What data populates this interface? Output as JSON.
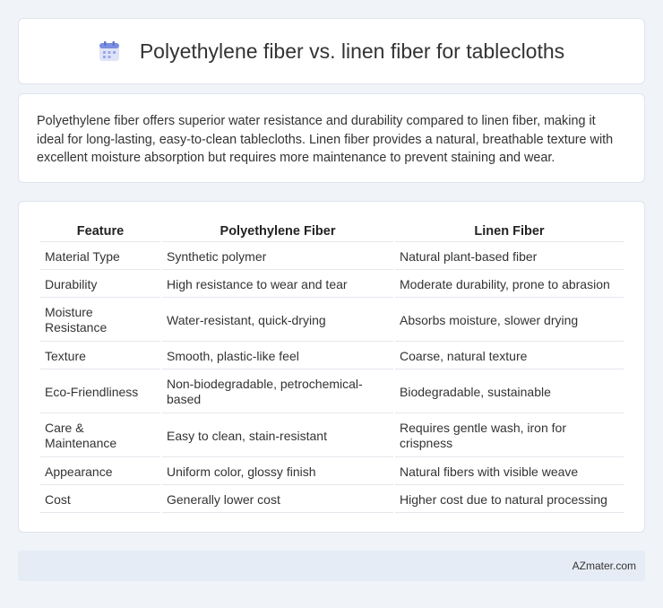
{
  "header": {
    "title": "Polyethylene fiber vs. linen fiber for tablecloths",
    "icon": "calendar-icon"
  },
  "summary": {
    "text": "Polyethylene fiber offers superior water resistance and durability compared to linen fiber, making it ideal for long-lasting, easy-to-clean tablecloths. Linen fiber provides a natural, breathable texture with excellent moisture absorption but requires more maintenance to prevent staining and wear."
  },
  "table": {
    "headers": [
      "Feature",
      "Polyethylene Fiber",
      "Linen Fiber"
    ],
    "rows": [
      [
        "Material Type",
        "Synthetic polymer",
        "Natural plant-based fiber"
      ],
      [
        "Durability",
        "High resistance to wear and tear",
        "Moderate durability, prone to abrasion"
      ],
      [
        "Moisture Resistance",
        "Water-resistant, quick-drying",
        "Absorbs moisture, slower drying"
      ],
      [
        "Texture",
        "Smooth, plastic-like feel",
        "Coarse, natural texture"
      ],
      [
        "Eco-Friendliness",
        "Non-biodegradable, petrochemical-based",
        "Biodegradable, sustainable"
      ],
      [
        "Care & Maintenance",
        "Easy to clean, stain-resistant",
        "Requires gentle wash, iron for crispness"
      ],
      [
        "Appearance",
        "Uniform color, glossy finish",
        "Natural fibers with visible weave"
      ],
      [
        "Cost",
        "Generally lower cost",
        "Higher cost due to natural processing"
      ]
    ]
  },
  "footer": {
    "brand": "AZmater.com"
  }
}
